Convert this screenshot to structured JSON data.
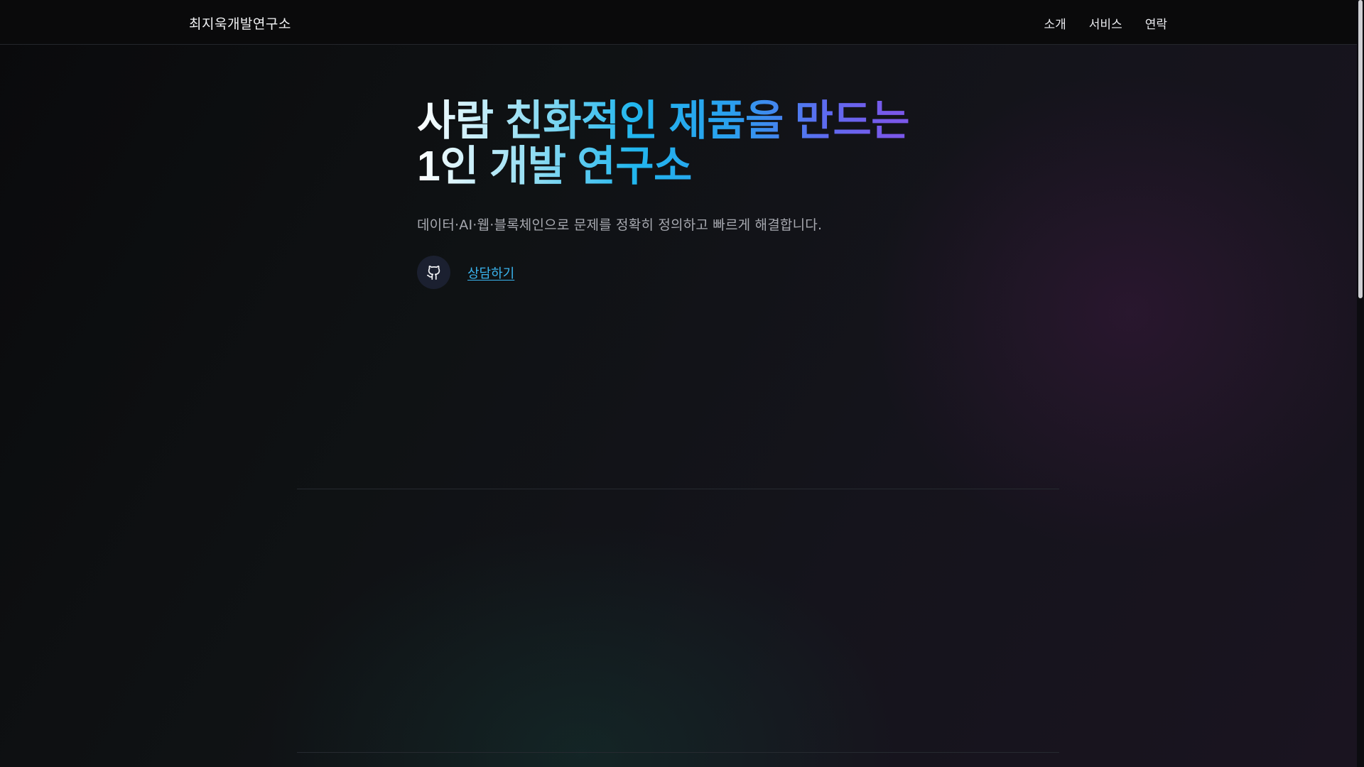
{
  "header": {
    "brand": "최지욱개발연구소",
    "nav": [
      {
        "label": "소개"
      },
      {
        "label": "서비스"
      },
      {
        "label": "연락"
      }
    ]
  },
  "hero": {
    "title_line1": "사람 친화적인 제품을 만드는",
    "title_line2": "1인 개발 연구소",
    "subtitle": "데이터·AI·웹·블록체인으로 문제를 정확히 정의하고 빠르게 해결합니다.",
    "github_icon": "github-icon",
    "cta_label": "상담하기"
  },
  "colors": {
    "accent": "#22b6ee",
    "accent_end": "#7a58ea",
    "link": "#3ab4ee"
  }
}
